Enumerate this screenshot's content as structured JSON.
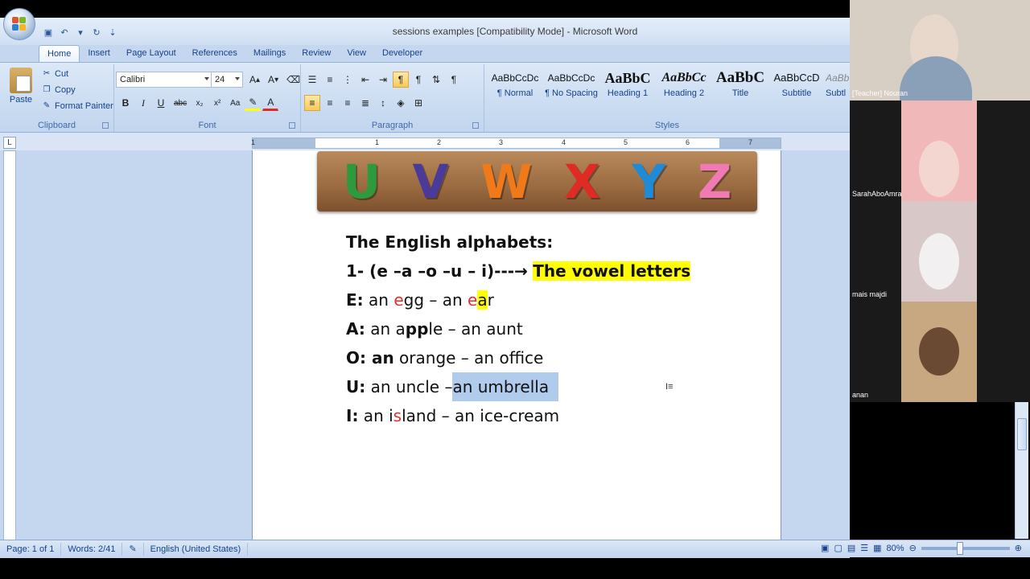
{
  "window": {
    "title": "sessions examples [Compatibility Mode] - Microsoft Word"
  },
  "tabs": [
    "Home",
    "Insert",
    "Page Layout",
    "References",
    "Mailings",
    "Review",
    "View",
    "Developer"
  ],
  "clipboard": {
    "paste": "Paste",
    "cut": "Cut",
    "copy": "Copy",
    "format_painter": "Format Painter",
    "label": "Clipboard"
  },
  "font": {
    "name": "Calibri",
    "size": "24",
    "label": "Font"
  },
  "paragraph": {
    "label": "Paragraph"
  },
  "styles": {
    "label": "Styles",
    "items": [
      {
        "sample": "AaBbCcDc",
        "name": "¶ Normal"
      },
      {
        "sample": "AaBbCcDc",
        "name": "¶ No Spacing"
      },
      {
        "sample": "AaBbC",
        "name": "Heading 1"
      },
      {
        "sample": "AaBbCc",
        "name": "Heading 2"
      },
      {
        "sample": "AaBbC",
        "name": "Title"
      },
      {
        "sample": "AaBbCcD",
        "name": "Subtitle"
      },
      {
        "sample": "AaBb",
        "name": "Subtl"
      }
    ]
  },
  "ruler": {
    "numbers": [
      "1",
      "1",
      "2",
      "3",
      "4",
      "5",
      "6",
      "7"
    ]
  },
  "banner_letters": [
    {
      "ch": "U",
      "color": "#2e9a3e"
    },
    {
      "ch": "V",
      "color": "#4a3a9a"
    },
    {
      "ch": "W",
      "color": "#f07a1a"
    },
    {
      "ch": "X",
      "color": "#e02a24"
    },
    {
      "ch": "Y",
      "color": "#1f8bd6"
    },
    {
      "ch": "Z",
      "color": "#f07ab4"
    }
  ],
  "document": {
    "heading": "The English alphabets:",
    "line1_prefix": "1- (e –a –o –u – i)---",
    "line1_arrow": "→",
    "line1_highlight": "The vowel letters",
    "e_label": "E:",
    "e_text1": " an ",
    "e_red1": "e",
    "e_text2": "gg – an ",
    "e_red2": "e",
    "e_hl": "a",
    "e_text3": "r",
    "a_label": "A:",
    "a_text1": " an a",
    "a_bold": "pp",
    "a_text2": "le – an aunt",
    "o_label": "O:",
    "o_bold": " an",
    "o_text": " orange – an office",
    "u_label": "U:",
    "u_text": " an uncle –",
    "u_sel": "an umbrella",
    "i_label": "I:",
    "i_text1": " an i",
    "i_red": "s",
    "i_text2": "land – an ice-cream"
  },
  "status": {
    "page": "Page: 1 of 1",
    "words": "Words: 2/41",
    "language": "English (United States)",
    "zoom": "80%"
  },
  "participants": [
    {
      "name": "[Teacher] Nouran"
    },
    {
      "name": "SarahAboAmra"
    },
    {
      "name": "mais majdi"
    },
    {
      "name": "anan"
    }
  ]
}
